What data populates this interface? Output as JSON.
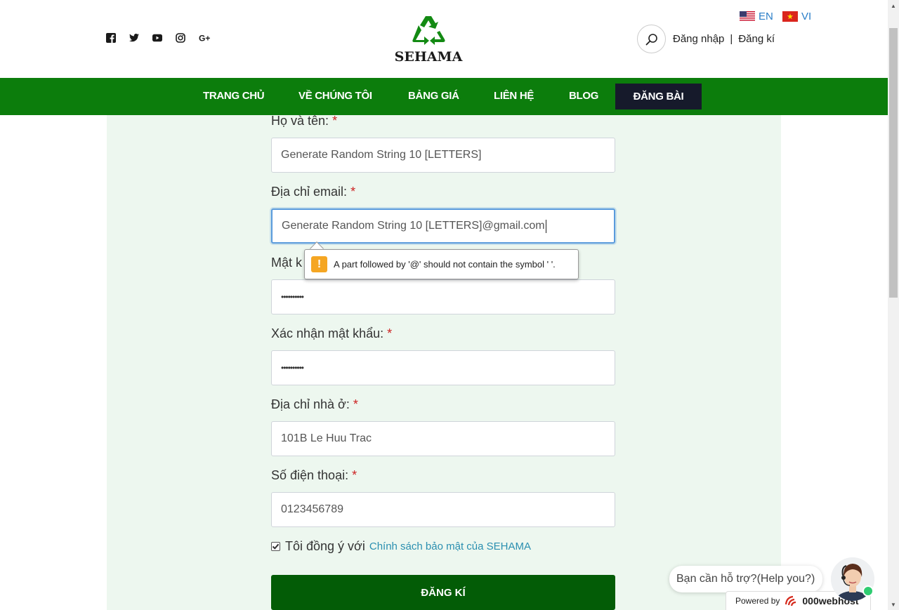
{
  "header": {
    "social_icons": [
      "facebook-icon",
      "twitter-icon",
      "youtube-icon",
      "instagram-icon",
      "google-plus-icon"
    ],
    "logo_text": "SEHAMA",
    "languages": [
      {
        "code": "EN",
        "flag": "us-flag-icon"
      },
      {
        "code": "VI",
        "flag": "vn-flag-icon"
      }
    ],
    "login_label": "Đăng nhập",
    "separator": "|",
    "register_label": "Đăng kí"
  },
  "nav": {
    "items": [
      {
        "label": "TRANG CHỦ"
      },
      {
        "label": "VỀ CHÚNG TÔI"
      },
      {
        "label": "BẢNG GIÁ"
      },
      {
        "label": "LIÊN HỆ"
      },
      {
        "label": "BLOG"
      },
      {
        "label": "ĐĂNG BÀI",
        "active": true
      }
    ]
  },
  "form": {
    "fullname": {
      "label": "Họ và tên:",
      "required": "*",
      "value": "Generate Random String 10 [LETTERS]"
    },
    "email": {
      "label": "Địa chỉ email:",
      "required": "*",
      "value": "Generate Random String 10 [LETTERS]@gmail.com"
    },
    "password": {
      "label": "Mật k",
      "required": "*",
      "value": "••••••••••"
    },
    "confirm_password": {
      "label": "Xác nhận mật khẩu:",
      "required": "*",
      "value": "••••••••••"
    },
    "address": {
      "label": "Địa chỉ nhà ở:",
      "required": "*",
      "value": "101B Le Huu Trac"
    },
    "phone": {
      "label": "Số điện thoại:",
      "required": "*",
      "value": "0123456789"
    },
    "agree_text": "Tôi đồng ý với",
    "agree_link": "Chính sách bảo mật của SEHAMA",
    "agree_checked": true,
    "submit_label": "ĐĂNG KÍ"
  },
  "validation_tooltip": {
    "icon": "!",
    "message": "A part followed by '@' should not contain the symbol ' '."
  },
  "help_widget": {
    "prompt": "Bạn cần hỗ trợ?(Help you?)",
    "powered_by": "Powered by",
    "brand": "000webhost"
  },
  "colors": {
    "nav_bg": "#0c7d0c",
    "nav_active_bg": "#161a2b",
    "content_bg": "#edf7ef",
    "submit_bg": "#035c06",
    "link": "#2a8fb0",
    "required": "#cc2222"
  }
}
